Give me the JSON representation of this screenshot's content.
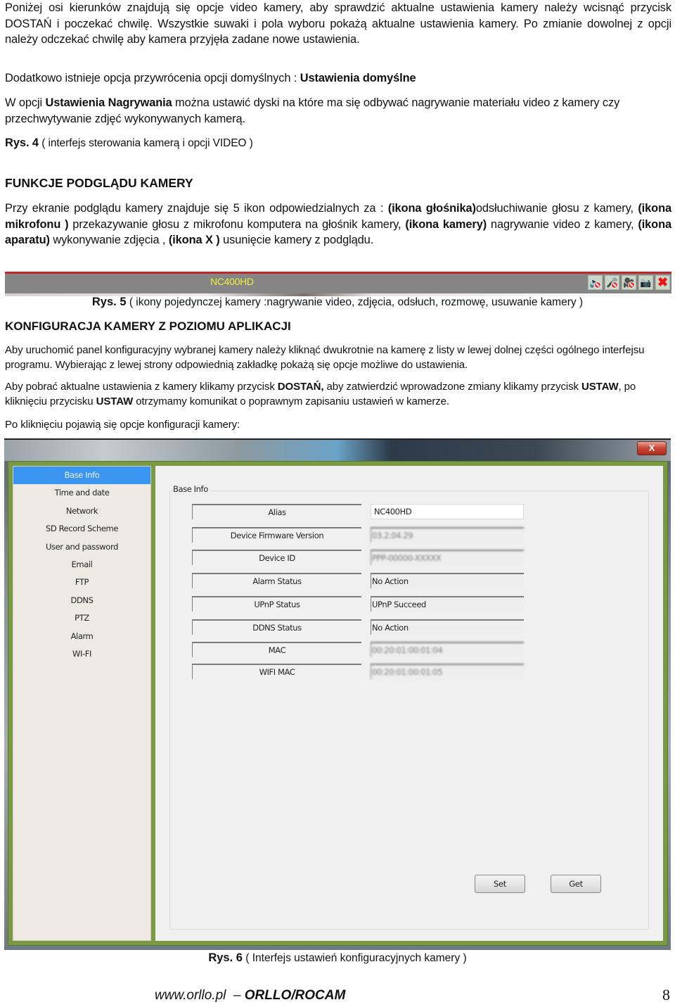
{
  "intro": {
    "para1": "Poniżej osi kierunków znajdują się opcje video kamery, aby sprawdzić aktualne ustawienia kamery należy wcisnąć przycisk DOSTAŃ i poczekać chwilę. Wszystkie suwaki i pola wyboru pokażą aktualne ustawienia kamery.  Po zmianie dowolnej z opcji należy odczekać chwilę aby kamera przyjęła zadane nowe ustawienia.",
    "para2_prefix": "Dodatkowo istnieje opcja przywrócenia opcji domyślnych : ",
    "para2_bold": "Ustawienia domyślne",
    "para3_prefix": "W opcji ",
    "para3_bold": "Ustawienia Nagrywania",
    "para3_suffix": " można ustawić dyski na które ma się odbywać nagrywanie materiału video z kamery czy przechwytywanie zdjęć wykonywanych kamerą.",
    "fig4_label": "Rys. 4",
    "fig4_caption": " ( interfejs sterowania kamerą i opcji VIDEO )"
  },
  "section_preview": {
    "heading": "FUNKCJE PODGLĄDU KAMERY",
    "text": [
      {
        "t": "Przy ekranie podglądu kamery znajduje się 5 ikon odpowiedzialnych za : ",
        "b": false
      },
      {
        "t": "(ikona głośnika)",
        "b": true
      },
      {
        "t": "odsłuchiwanie głosu z kamery, ",
        "b": false
      },
      {
        "t": "(ikona mikrofonu )",
        "b": true
      },
      {
        "t": " przekazywanie głosu z mikrofonu komputera na głośnik kamery, ",
        "b": false
      },
      {
        "t": "(ikona kamery)",
        "b": true
      },
      {
        "t": " nagrywanie video z kamery, ",
        "b": false
      },
      {
        "t": "(ikona aparatu)",
        "b": true
      },
      {
        "t": " wykonywanie zdjęcia , ",
        "b": false
      },
      {
        "t": "(ikona X )",
        "b": true
      },
      {
        "t": " usunięcie kamery z podglądu.",
        "b": false
      }
    ],
    "camera_bar": {
      "camera_name": "NC400HD",
      "icons": [
        "speaker-muted-icon",
        "microphone-muted-icon",
        "record-video-muted-icon",
        "snapshot-camera-icon",
        "close-x-icon"
      ],
      "accent_color": "#c0262b",
      "name_color": "#f2ee3a"
    },
    "fig5_label": "Rys. 5",
    "fig5_caption": " ( ikony pojedynczej kamery :nagrywanie video, zdjęcia, odsłuch, rozmowę, usuwanie kamery )"
  },
  "section_config": {
    "heading": "KONFIGURACJA KAMERY Z POZIOMU APLIKACJI",
    "para1": "Aby uruchomić panel konfiguracyjny wybranej kamery należy kliknąć dwukrotnie na kamerę z listy w lewej dolnej części ogólnego interfejsu programu.  Wybierając z lewej strony odpowiednią zakładkę pokażą się opcje możliwe do ustawienia.",
    "para2": [
      {
        "t": "Aby pobrać aktualne ustawienia z kamery klikamy przycisk ",
        "b": false
      },
      {
        "t": "DOSTAŃ,",
        "b": true
      },
      {
        "t": " aby zatwierdzić wprowadzone zmiany klikamy przycisk ",
        "b": false
      },
      {
        "t": "USTAW",
        "b": true
      },
      {
        "t": ", po kliknięciu przycisku ",
        "b": false
      },
      {
        "t": "USTAW",
        "b": true
      },
      {
        "t": " otrzymamy komunikat o poprawnym zapisaniu ustawień w kamerze.",
        "b": false
      }
    ],
    "para3": "Po kliknięciu pojawią się opcje konfiguracji kamery:"
  },
  "config_window": {
    "close_label": "X",
    "sidebar": [
      {
        "label": "Base Info",
        "active": true
      },
      {
        "label": "Time and date",
        "active": false
      },
      {
        "label": "Network",
        "active": false
      },
      {
        "label": "SD Record Scheme",
        "active": false
      },
      {
        "label": "User and password",
        "active": false
      },
      {
        "label": "Email",
        "active": false
      },
      {
        "label": "FTP",
        "active": false
      },
      {
        "label": "DDNS",
        "active": false
      },
      {
        "label": "PTZ",
        "active": false
      },
      {
        "label": "Alarm",
        "active": false
      },
      {
        "label": "WI-FI",
        "active": false
      }
    ],
    "group_title": "Base Info",
    "fields": [
      {
        "label": "Alias",
        "value": "NC400HD",
        "editable": true,
        "blurred": false
      },
      {
        "label": "Device Firmware Version",
        "value": "03.2.04.29",
        "editable": false,
        "blurred": true
      },
      {
        "label": "Device ID",
        "value": "PPP-00000-XXXXX",
        "editable": false,
        "blurred": true
      },
      {
        "label": "Alarm Status",
        "value": "No Action",
        "editable": false,
        "blurred": false
      },
      {
        "label": "UPnP Status",
        "value": "UPnP Succeed",
        "editable": false,
        "blurred": false
      },
      {
        "label": "DDNS Status",
        "value": "No Action",
        "editable": false,
        "blurred": false
      },
      {
        "label": "MAC",
        "value": "00:20:01:00:01:04",
        "editable": false,
        "blurred": true
      },
      {
        "label": "WIFI MAC",
        "value": "00:20:01:00:01:05",
        "editable": false,
        "blurred": true
      }
    ],
    "set_label": "Set",
    "get_label": "Get",
    "active_color": "#3a95f0",
    "frame_color": "#7a9a42"
  },
  "fig6_label": "Rys. 6",
  "fig6_caption": " ( Interfejs ustawień konfiguracyjnych kamery )",
  "footer": {
    "site": "www.orllo.pl",
    "dash": "  – ",
    "brand": "ORLLO/ROCAM",
    "page_number": "8"
  }
}
